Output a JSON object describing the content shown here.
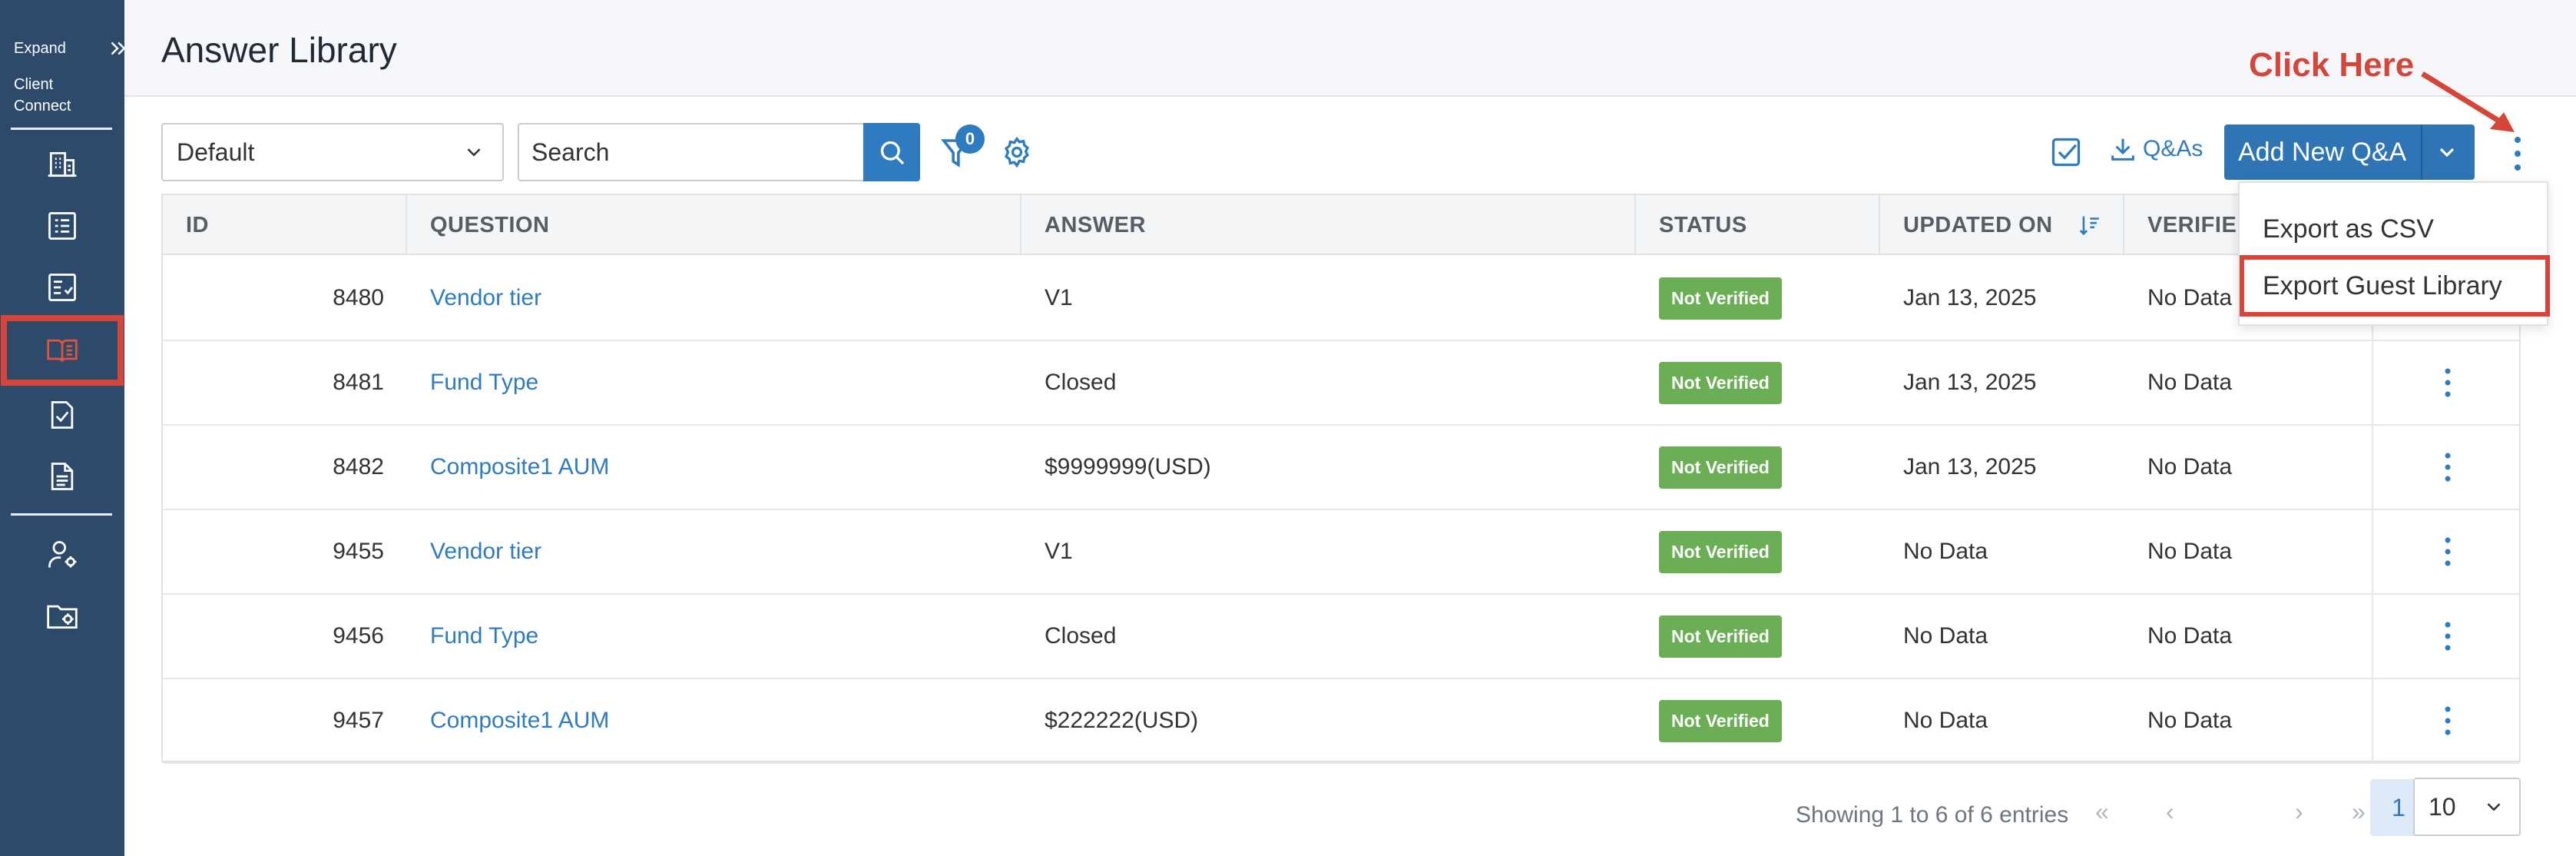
{
  "sidebar": {
    "expand_label": "Expand",
    "client_line1": "Client",
    "client_line2": "Connect",
    "items": [
      {
        "icon": "building-icon"
      },
      {
        "icon": "list-icon"
      },
      {
        "icon": "checklist-icon"
      },
      {
        "icon": "book-open-icon",
        "active": true
      },
      {
        "icon": "document-check-icon"
      },
      {
        "icon": "document-icon"
      },
      {
        "icon": "user-settings-icon"
      },
      {
        "icon": "folder-settings-icon"
      }
    ]
  },
  "header": {
    "title": "Answer Library"
  },
  "toolbar": {
    "view_select": "Default",
    "search_placeholder": "Search",
    "filter_count": "0",
    "qa_download_label": "Q&As",
    "add_button_label": "Add New Q&A"
  },
  "annotation": {
    "text": "Click Here",
    "color": "#d6453a"
  },
  "table": {
    "columns": [
      "ID",
      "QUESTION",
      "ANSWER",
      "STATUS",
      "UPDATED ON",
      "VERIFIED"
    ],
    "rows": [
      {
        "id": "8480",
        "question": "Vendor tier",
        "answer": "V1",
        "status": "Not Verified",
        "updated": "Jan 13, 2025",
        "verified": "No Data"
      },
      {
        "id": "8481",
        "question": "Fund Type",
        "answer": "Closed",
        "status": "Not Verified",
        "updated": "Jan 13, 2025",
        "verified": "No Data"
      },
      {
        "id": "8482",
        "question": "Composite1 AUM",
        "answer": "$9999999(USD)",
        "status": "Not Verified",
        "updated": "Jan 13, 2025",
        "verified": "No Data"
      },
      {
        "id": "9455",
        "question": "Vendor tier",
        "answer": "V1",
        "status": "Not Verified",
        "updated": "No Data",
        "verified": "No Data"
      },
      {
        "id": "9456",
        "question": "Fund Type",
        "answer": "Closed",
        "status": "Not Verified",
        "updated": "No Data",
        "verified": "No Data"
      },
      {
        "id": "9457",
        "question": "Composite1 AUM",
        "answer": "$222222(USD)",
        "status": "Not Verified",
        "updated": "No Data",
        "verified": "No Data"
      }
    ]
  },
  "pagination": {
    "showing": "Showing 1 to 6 of 6 entries",
    "current_page": "1",
    "first": "«",
    "prev": "‹",
    "next": "›",
    "last": "»",
    "page_size": "10"
  },
  "menu": {
    "items": [
      "Export as CSV",
      "Export Guest Library"
    ]
  },
  "colors": {
    "sidebar": "#2e4a6b",
    "primary": "#2f74b5",
    "status_green": "#6cae56",
    "annotation_red": "#d6453a"
  }
}
